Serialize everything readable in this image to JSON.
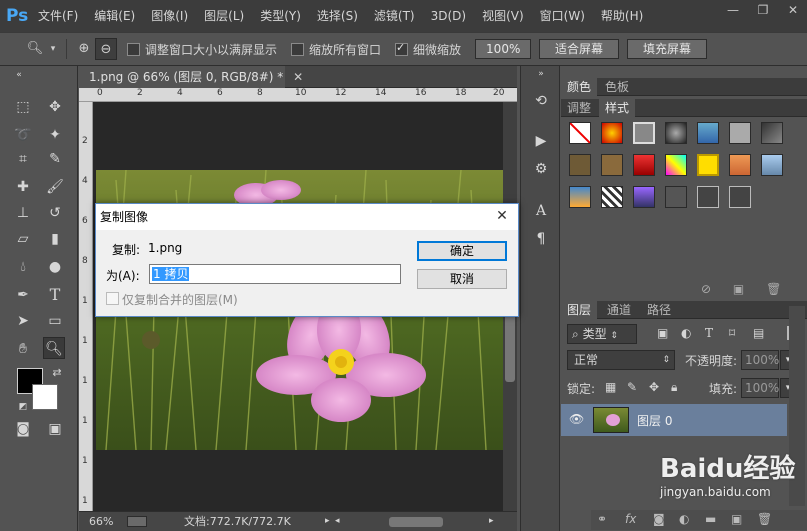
{
  "app": {
    "logo": "Ps"
  },
  "menu": [
    "文件(F)",
    "编辑(E)",
    "图像(I)",
    "图层(L)",
    "类型(Y)",
    "选择(S)",
    "滤镜(T)",
    "3D(D)",
    "视图(V)",
    "窗口(W)",
    "帮助(H)"
  ],
  "options": {
    "resize_windows_label": "调整窗口大小以满屏显示",
    "zoom_all_label": "缩放所有窗口",
    "scrubby_zoom_label": "细微缩放",
    "zoom_value": "100%",
    "fit_screen": "适合屏幕",
    "fill_screen": "填充屏幕"
  },
  "document": {
    "tab_title": "1.png @ 66% (图层 0, RGB/8#) *",
    "zoom": "66%",
    "doc_size": "文档:772.7K/772.7K"
  },
  "rulers": {
    "h": [
      "0",
      "2",
      "4",
      "6",
      "8",
      "10",
      "12",
      "14",
      "16",
      "18",
      "20"
    ],
    "v": [
      "2",
      "4",
      "6",
      "8",
      "1",
      "1",
      "1",
      "1",
      "1",
      "1",
      "1"
    ]
  },
  "dialog": {
    "title": "复制图像",
    "source_label": "复制:",
    "source_value": "1.png",
    "as_label": "为(A):",
    "as_value": "1 拷贝",
    "merged_only_label": "仅复制合并的图层(M)",
    "ok": "确定",
    "cancel": "取消"
  },
  "panels": {
    "color_tab": "颜色",
    "swatches_tab": "色板",
    "adjust_tab": "调整",
    "styles_tab": "样式",
    "layers_tab": "图层",
    "channels_tab": "通道",
    "paths_tab": "路径",
    "filter_kind": "类型",
    "blend_mode": "正常",
    "opacity_label": "不透明度:",
    "opacity_value": "100%",
    "lock_label": "锁定:",
    "fill_label": "填充:",
    "fill_value": "100%",
    "layer_name": "图层 0"
  },
  "watermark": {
    "brand": "Baidu经验",
    "url": "jingyan.baidu.com"
  },
  "colors": {
    "accent": "#0078d7",
    "ps_blue": "#49a8f5",
    "layer_selected": "#6a7f9c"
  }
}
